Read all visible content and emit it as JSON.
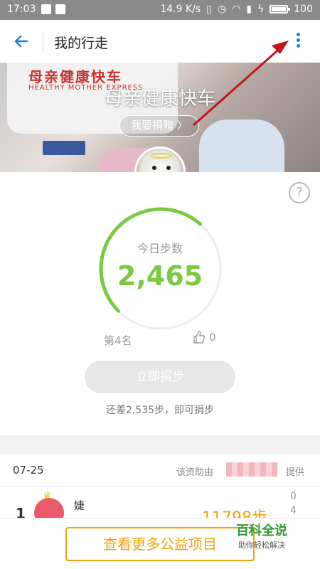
{
  "status_bar": {
    "time": "17:03",
    "speed": "14.9 K/s",
    "battery": "100",
    "battery_level": 1.0
  },
  "app_bar": {
    "title": "我的行走",
    "back_icon": "arrow-left-icon",
    "menu_icon": "more-vertical-icon"
  },
  "banner": {
    "headline": "母亲健康快车",
    "van_text": "母亲健康快车",
    "van_sub": "HEALTHY MOTHER EXPRESS",
    "donate_label": "我要捐赠 〉"
  },
  "today": {
    "label": "今日步数",
    "steps": "2,465",
    "progress": 0.49,
    "rank": "第4名",
    "likes": "0",
    "cta_label": "立即捐步",
    "note": "还差2,535步，即可捐步",
    "help": "?"
  },
  "list": {
    "date": "07-25",
    "sponsor_label": "该资助由",
    "provide_label": "提供",
    "rows": [
      {
        "rank": "1",
        "name": "婕",
        "steps": "11798步",
        "likes_top": "0",
        "likes_bottom": "4"
      }
    ]
  },
  "bottom": {
    "more_label": "查看更多公益项目"
  },
  "watermark": {
    "line1": "百科全说",
    "line2": "助你轻松解决"
  },
  "colors": {
    "accent": "#7ac943",
    "brand_blue": "#1a82d6",
    "orange": "#f0a20c",
    "annotation_red": "#c3161c"
  }
}
